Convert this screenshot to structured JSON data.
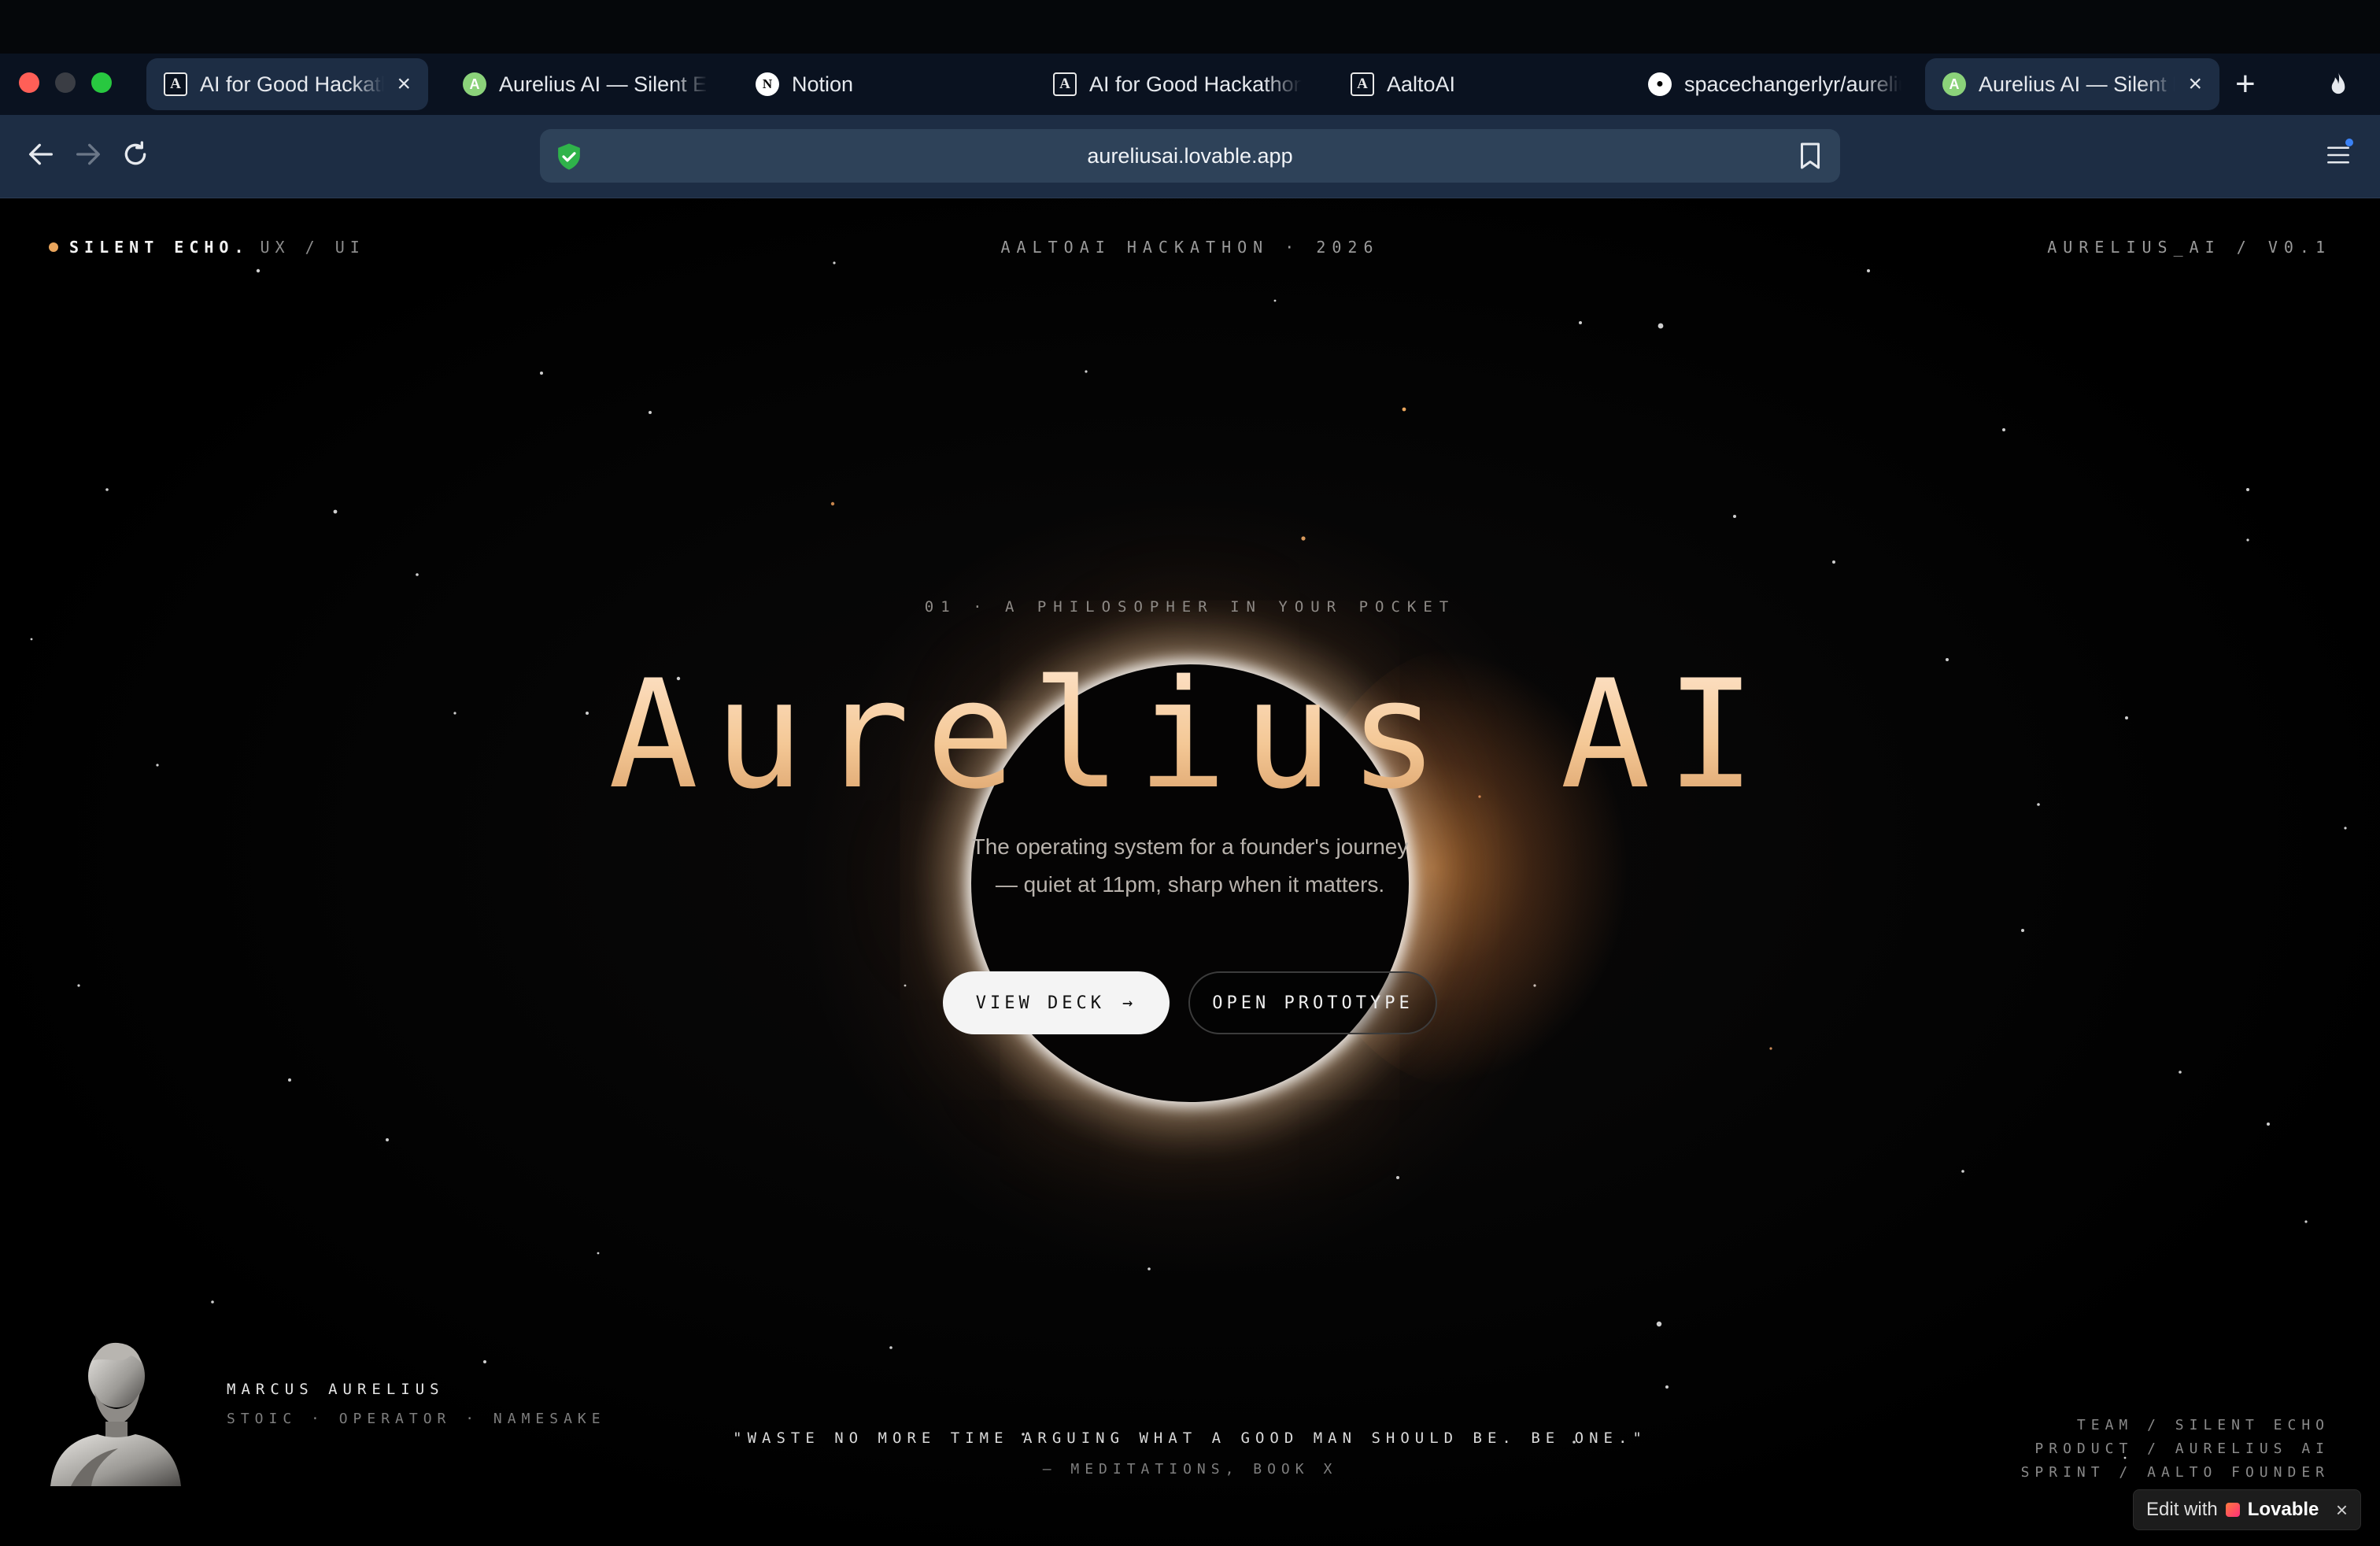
{
  "browser": {
    "tabs": [
      {
        "title": "AI for Good Hackathon",
        "favicon": "anthropic-icon",
        "active": true,
        "closable": true
      },
      {
        "title": "Aurelius AI — Silent Echo",
        "favicon": "lovable-icon",
        "active": false,
        "closable": false
      },
      {
        "title": "Notion",
        "favicon": "notion-icon",
        "active": false,
        "closable": false
      },
      {
        "title": "AI for Good Hackathon",
        "favicon": "anthropic-icon",
        "active": false,
        "closable": false
      },
      {
        "title": "AaltoAI",
        "favicon": "anthropic-icon",
        "active": false,
        "closable": false
      },
      {
        "title": "spacechangerlyr/aurelius",
        "favicon": "github-icon",
        "active": false,
        "closable": false
      },
      {
        "title": "Aurelius AI — Silent Echo",
        "favicon": "lovable-icon",
        "active": true,
        "closable": true
      }
    ],
    "url": "aureliusai.lovable.app",
    "new_tab": "+",
    "close_glyph": "×",
    "favicon_letters": {
      "anthropic": "A",
      "lovable": "A",
      "notion": "N",
      "github": "●"
    }
  },
  "header": {
    "brand_name": "SILENT ECHO.",
    "brand_sub": "UX / UI",
    "event": "AALTOAI HACKATHON · 2026",
    "version": "AURELIUS_AI / V0.1"
  },
  "hero": {
    "kicker": "01 · A PHILOSOPHER IN YOUR POCKET",
    "title": "Aurelius AI",
    "tagline_line1": "The operating system for a founder's journey",
    "tagline_line2": "— quiet at 11pm, sharp when it matters.",
    "primary_cta": "VIEW DECK",
    "primary_cta_arrow": "→",
    "secondary_cta": "OPEN PROTOTYPE"
  },
  "footer": {
    "person_name": "MARCUS AURELIUS",
    "person_role": "STOIC · OPERATOR · NAMESAKE",
    "quote": "\"WASTE NO MORE TIME ARGUING WHAT A GOOD MAN SHOULD BE. BE ONE.\"",
    "quote_source": "— MEDITATIONS, BOOK X",
    "credits": [
      "TEAM / SILENT ECHO",
      "PRODUCT / AURELIUS AI",
      "SPRINT / AALTO FOUNDER"
    ]
  },
  "lovable_badge": {
    "prefix": "Edit with",
    "brand": "Lovable",
    "close": "×"
  },
  "colors": {
    "accent": "#e9a55c",
    "title_gradient_top": "#ffe6cf",
    "title_gradient_bottom": "#d69a62",
    "chrome_bg": "#1d2d44"
  }
}
